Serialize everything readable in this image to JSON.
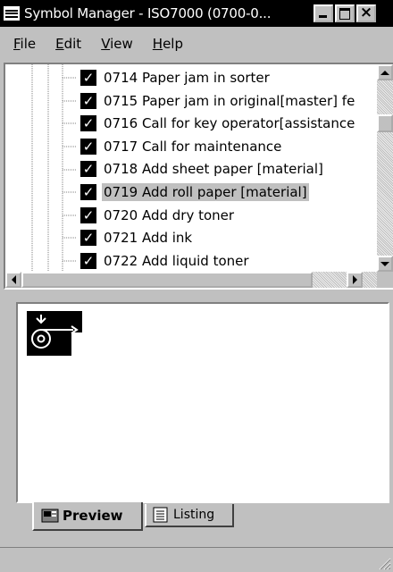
{
  "window": {
    "title": "Symbol Manager - ISO7000  (0700-0...",
    "controls": [
      "minimize",
      "maximize",
      "close"
    ]
  },
  "menu": [
    {
      "label": "File",
      "mnemonic": "F",
      "rest": "ile"
    },
    {
      "label": "Edit",
      "mnemonic": "E",
      "rest": "dit"
    },
    {
      "label": "View",
      "mnemonic": "V",
      "rest": "iew"
    },
    {
      "label": "Help",
      "mnemonic": "H",
      "rest": "elp"
    }
  ],
  "tree": {
    "selected": "0719 Add roll paper [material]",
    "items": [
      {
        "label": "0714 Paper jam in sorter",
        "checked": true
      },
      {
        "label": "0715 Paper jam in original[master] fe",
        "checked": true
      },
      {
        "label": "0716 Call for key operator[assistance",
        "checked": true
      },
      {
        "label": "0717 Call for maintenance",
        "checked": true
      },
      {
        "label": "0718 Add sheet paper [material]",
        "checked": true
      },
      {
        "label": "0719 Add roll paper [material]",
        "checked": true
      },
      {
        "label": "0720 Add dry toner",
        "checked": true
      },
      {
        "label": "0721 Add ink",
        "checked": true
      },
      {
        "label": "0722 Add liquid toner",
        "checked": true
      }
    ]
  },
  "tabs": [
    {
      "label": "Preview",
      "active": true,
      "icon": "preview-icon"
    },
    {
      "label": "Listing",
      "active": false,
      "icon": "listing-icon"
    }
  ],
  "colors": {
    "face": "#c0c0c0",
    "selection": "#c0c0c0",
    "titlebar": "#000000"
  }
}
